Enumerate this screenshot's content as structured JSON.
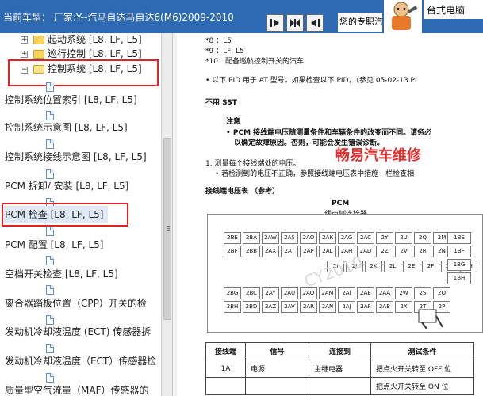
{
  "header": {
    "title": "当前车型： 厂家:Y--汽马自达马自达6(M6)2009-2010",
    "expert_text": "您的专职汽",
    "ad_text": "台式电脑"
  },
  "tree": {
    "items": [
      {
        "label": "起动系统 [L8, LF, L5]"
      },
      {
        "label": "巡行控制 [L8, LF, L5]"
      },
      {
        "label": "控制系统 [L8, LF, L5]"
      },
      {
        "label": "控制系统位置索引 [L8, LF, L5]"
      },
      {
        "label": "控制系统示意图 [L8, LF, L5]"
      },
      {
        "label": "控制系统接线示意图 [L8, LF, L5]"
      },
      {
        "label": "PCM 拆卸/ 安装 [L8, LF, L5]"
      },
      {
        "label": "PCM 检查 [L8, LF, L5]"
      },
      {
        "label": "PCM 配置 [L8, LF, L5]"
      },
      {
        "label": "空档开关检查 [L8, LF, L5]"
      },
      {
        "label": "离合器踏板位置（CPP）开关的检"
      },
      {
        "label": "发动机冷却液温度 (ECT) 传感器拆"
      },
      {
        "label": "发动机冷却液温度（ECT）传感器检"
      },
      {
        "label": "质量型空气流量（MAF）传感器的"
      }
    ]
  },
  "doc": {
    "note8": "*8 ：L5",
    "note9": "*9 ：LF, L5",
    "note10": "*10：配备巡航控制开关的汽车",
    "pid_line": "• 以下 PID 用于 AT 型号。如果检查以下 PID，（参见 05-02-13 PI",
    "not_used": "不用 SST",
    "caution_title": "注意",
    "caution_1": "• PCM 接线端电压随测量条件和车辆条件的改变而不同。请务必",
    "caution_2": "以确定故障原因。否则，可能会发生错误诊断。",
    "step1": "1. 测量每个接线端处的电压。",
    "step1_sub": "• 若检测到的电压不正确，参照接线端电压表中措施一栏检查相",
    "table_title": "接线端电压表 （参考）",
    "conn_title": "PCM",
    "conn_sub": "线束侧连接器",
    "watermark": "畅易汽车维修",
    "faint_mark": "CY2010",
    "table": {
      "headers": [
        "接线端",
        "信号",
        "连接到",
        "测试条件"
      ],
      "rows": [
        [
          "1A",
          "电源",
          "主继电器",
          "把点火开关转至 OFF 位"
        ],
        [
          "",
          "",
          "",
          "把点火开关转至 ON 位"
        ]
      ]
    },
    "conn_rows": [
      [
        "2BE",
        "2BA",
        "2AW",
        "2AS",
        "2AO",
        "2AK",
        "2AG",
        "2AC",
        "2Y",
        "2U",
        "2Q",
        "2M"
      ],
      [
        "2BF",
        "2BB",
        "2AX",
        "2AT",
        "2AP",
        "2AL",
        "2AH",
        "2AD",
        "2Z",
        "2V",
        "2R",
        "2N"
      ],
      [
        "2BG",
        "2BC",
        "2AY",
        "2AU",
        "2AQ",
        "2AM",
        "2AI",
        "2AE",
        "2AA",
        "2W",
        "2S",
        "2O"
      ],
      [
        "2BH",
        "2BD",
        "2AZ",
        "2AV",
        "2AR",
        "2AN",
        "2AJ",
        "2AF",
        "2AB",
        "2X",
        "2T",
        "2P"
      ]
    ],
    "conn_mid": [
      "2I",
      "2J",
      "2K",
      "2L",
      "2E",
      "2F",
      "2G",
      "2H"
    ],
    "right_rows": [
      "1BE",
      "1BF",
      "1BG",
      "1BH"
    ]
  }
}
